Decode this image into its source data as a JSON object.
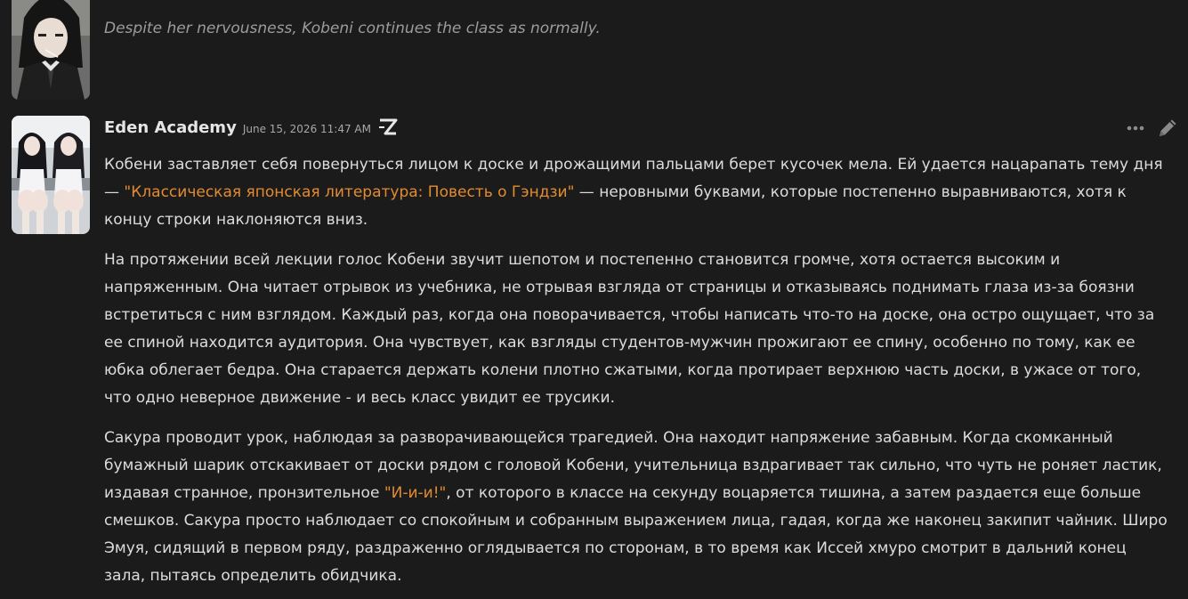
{
  "messages": [
    {
      "narration": "Despite her nervousness, Kobeni continues the class as normally."
    },
    {
      "author": "Eden Academy",
      "timestamp": "June 15, 2026 11:47 AM",
      "badge_icon": "z-badge-icon",
      "paragraphs": [
        {
          "before": "Кобени заставляет себя повернуться лицом к доске и дрожащими пальцами берет кусочек мела. Ей удается нацарапать тему дня — ",
          "quote": "\"Классическая японская литература: Повесть о Гэндзи\"",
          "after": " — неровными буквами, которые постепенно выравниваются, хотя к концу строки наклоняются вниз."
        },
        {
          "text": "На протяжении всей лекции голос Кобени звучит шепотом и постепенно становится громче, хотя остается высоким и напряженным. Она читает отрывок из учебника, не отрывая взгляда от страницы и отказываясь поднимать глаза из-за боязни встретиться с ним взглядом. Каждый раз, когда она поворачивается, чтобы написать что-то на доске, она остро ощущает, что за ее спиной находится аудитория. Она чувствует, как взгляды студентов-мужчин прожигают ее спину, особенно по тому, как ее юбка облегает бедра. Она старается держать колени плотно сжатыми, когда протирает верхнюю часть доски, в ужасе от того, что одно неверное движение - и весь класс увидит ее трусики."
        },
        {
          "before": "Сакура проводит урок, наблюдая за разворачивающейся трагедией. Она находит напряжение забавным. Когда скомканный бумажный шарик отскакивает от доски рядом с головой Кобени, учительница вздрагивает так сильно, что чуть не роняет ластик, издавая странное, пронзительное ",
          "quote": "\"И-и-и!\"",
          "after": ", от которого в классе на секунду воцаряется тишина, а затем раздается еще больше смешков. Сакура просто наблюдает со спокойным и собранным выражением лица, гадая, когда же наконец закипит чайник. Широ Эмуя, сидящий в первом ряду, раздраженно оглядывается по сторонам, в то время как Иссей хмуро смотрит в дальний конец зала, пытаясь определить обидчика."
        }
      ]
    }
  ],
  "colors": {
    "background": "#1b1b1b",
    "text": "#dcdcdc",
    "narration": "#9c9c9c",
    "quote": "#e38b30",
    "author": "#e6e6e6"
  }
}
